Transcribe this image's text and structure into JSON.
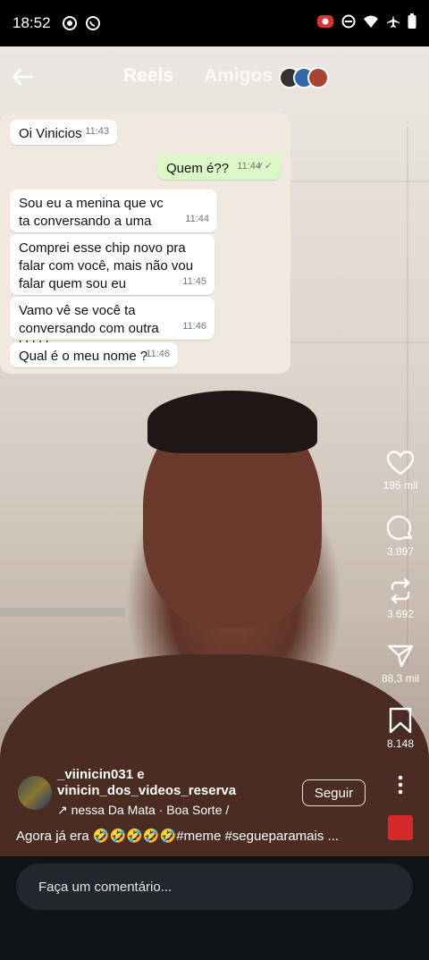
{
  "status": {
    "time": "18:52",
    "left_icons": [
      "record-icon",
      "whatsapp-icon"
    ],
    "right_icons": [
      "screen-record-icon",
      "dnd-icon",
      "wifi-icon",
      "airplane-icon",
      "battery-icon"
    ]
  },
  "nav": {
    "tabs": [
      {
        "label": "Reels",
        "active": true
      },
      {
        "label": "Amigos",
        "active": false
      }
    ]
  },
  "chat": {
    "messages": [
      {
        "text": "Oi Vinicios",
        "time": "11:43",
        "outgoing": false
      },
      {
        "text": "Quem é??",
        "time": "11:44",
        "outgoing": true
      },
      {
        "text": "Sou eu a menina que vc ta conversando a uma semana",
        "time": "11:44",
        "outgoing": false
      },
      {
        "text": "Comprei esse chip novo pra falar com você, mais não vou falar quem sou eu",
        "time": "11:45",
        "outgoing": false
      },
      {
        "text": "Vamo vê se você ta conversando com outra kkkkk",
        "time": "11:46",
        "outgoing": false
      },
      {
        "text": "Qual é o meu nome ?",
        "time": "11:46",
        "outgoing": false
      }
    ]
  },
  "actions": {
    "likes": "195 mil",
    "comments": "3.897",
    "reposts": "3.692",
    "shares": "88,3 mil",
    "saves": "8.148"
  },
  "post": {
    "user1": "_viinicin031 e",
    "user2": "vinicin_dos_videos_reserva",
    "follow_label": "Seguir",
    "music": "nessa Da Mata · Boa Sorte /",
    "caption": "Agora já era 🤣🤣🤣🤣🤣#meme #segueparamais ..."
  },
  "comment_placeholder": "Faça um comentário..."
}
